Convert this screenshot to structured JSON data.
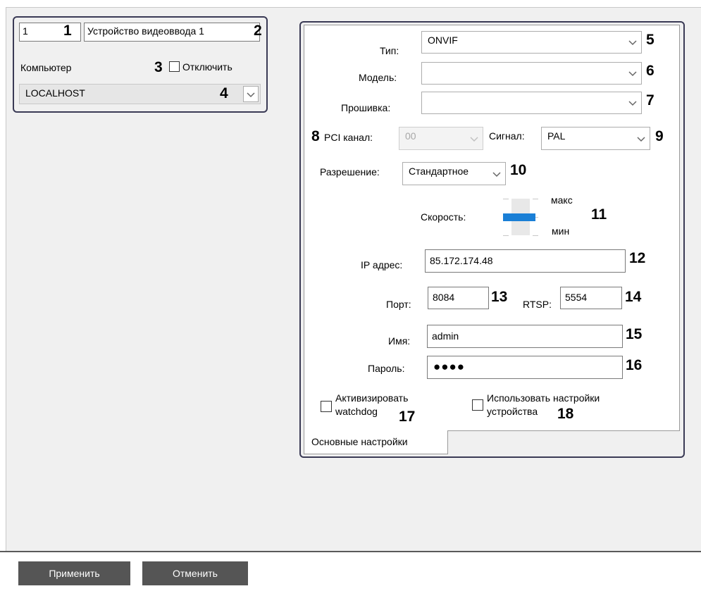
{
  "device_panel": {
    "id_value": "1",
    "name_value": "Устройство видеоввода 1",
    "computer_label": "Компьютер",
    "disable_label": "Отключить",
    "computer_value": "LOCALHOST"
  },
  "settings": {
    "type_label": "Тип:",
    "type_value": "ONVIF",
    "model_label": "Модель:",
    "model_value": "",
    "firmware_label": "Прошивка:",
    "firmware_value": "",
    "pci_label": "PCI канал:",
    "pci_value": "00",
    "signal_label": "Сигнал:",
    "signal_value": "PAL",
    "resolution_label": "Разрешение:",
    "resolution_value": "Стандартное",
    "speed_label": "Скорость:",
    "speed_max": "макс",
    "speed_min": "мин",
    "speed_level": 0.5,
    "ip_label": "IP адрес:",
    "ip_value": "85.172.174.48",
    "port_label": "Порт:",
    "port_value": "8084",
    "rtsp_label": "RTSP:",
    "rtsp_value": "5554",
    "name_label": "Имя:",
    "name_value": "admin",
    "password_label": "Пароль:",
    "password_value": "●●●●",
    "watchdog_label_line1": "Активизировать",
    "watchdog_label_line2": "watchdog",
    "use_device_settings_line1": "Использовать настройки",
    "use_device_settings_line2": "устройства"
  },
  "tab": {
    "main_settings": "Основные настройки"
  },
  "callouts": {
    "c1": "1",
    "c2": "2",
    "c3": "3",
    "c4": "4",
    "c5": "5",
    "c6": "6",
    "c7": "7",
    "c8": "8",
    "c9": "9",
    "c10": "10",
    "c11": "11",
    "c12": "12",
    "c13": "13",
    "c14": "14",
    "c15": "15",
    "c16": "16",
    "c17": "17",
    "c18": "18"
  },
  "buttons": {
    "apply": "Применить",
    "cancel": "Отменить"
  },
  "icons": {
    "dropdown": "chevron-down-icon",
    "checkbox": "checkbox-empty-icon"
  },
  "colors": {
    "slider_thumb": "#1a7fd6",
    "button_bg": "#555555",
    "panel_bg": "#f0f0f0"
  }
}
